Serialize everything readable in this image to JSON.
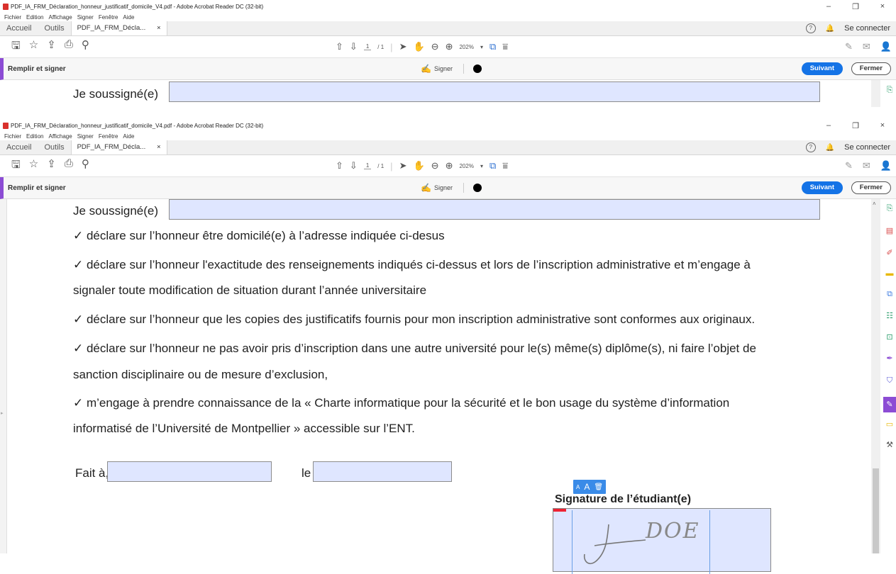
{
  "window": {
    "title": "PDF_IA_FRM_Déclaration_honneur_justificatif_domicile_V4.pdf - Adobe Acrobat Reader DC (32-bit)",
    "controls": {
      "minimize": "–",
      "maximize": "❐",
      "close": "×"
    }
  },
  "menu_top": [
    "Fichier",
    "Edition",
    "Affichage",
    "Signer",
    "Fenêtre",
    "Aide"
  ],
  "tabs": {
    "home": "Accueil",
    "tools": "Outils",
    "doc": "PDF_IA_FRM_Décla...",
    "close": "×",
    "help": "?",
    "bell": "🔔",
    "signin": "Se connecter"
  },
  "toolbar": {
    "page_current": "1",
    "page_total": "/ 1",
    "zoom": "202%",
    "zoom_caret": "▾"
  },
  "fillsign": {
    "label": "Remplir et signer",
    "signer": "Signer",
    "next": "Suivant",
    "close": "Fermer"
  },
  "document": {
    "soussigne": "Je soussigné(e)",
    "lines": [
      "✓ déclare sur l’honneur être domicilé(e) à l’adresse indiquée ci-desus",
      "✓ déclare sur l’honneur l'exactitude des renseignements indiqués ci-dessus et lors de l’inscription administrative et m’engage à",
      "signaler toute modification de situation durant l’année universitaire",
      "✓ déclare sur l’honneur que les copies des justificatifs fournis pour mon inscription administrative sont conformes aux originaux.",
      "✓ déclare sur l’honneur ne pas avoir pris d’inscription dans une autre université pour le(s) même(s) diplôme(s), ni faire l’objet de",
      "sanction disciplinaire ou de mesure d’exclusion,",
      "✓ m’engage à prendre connaissance de la « Charte informatique pour la sécurité et le bon usage du système d’information",
      "informatisé de l’Université de Montpellier » accessible sur l’ENT."
    ],
    "fait_a": "Fait à,",
    "le": "le",
    "signature_label": "Signature de l’étudiant(e)",
    "signature_text": "DOE",
    "sig_tools": {
      "small_a": "A",
      "big_a": "A",
      "trash": "🗑"
    }
  },
  "colors": {
    "accent": "#1473e6",
    "fillsign_bar": "#8c4cd4",
    "field_bg": "#dfe6ff"
  }
}
